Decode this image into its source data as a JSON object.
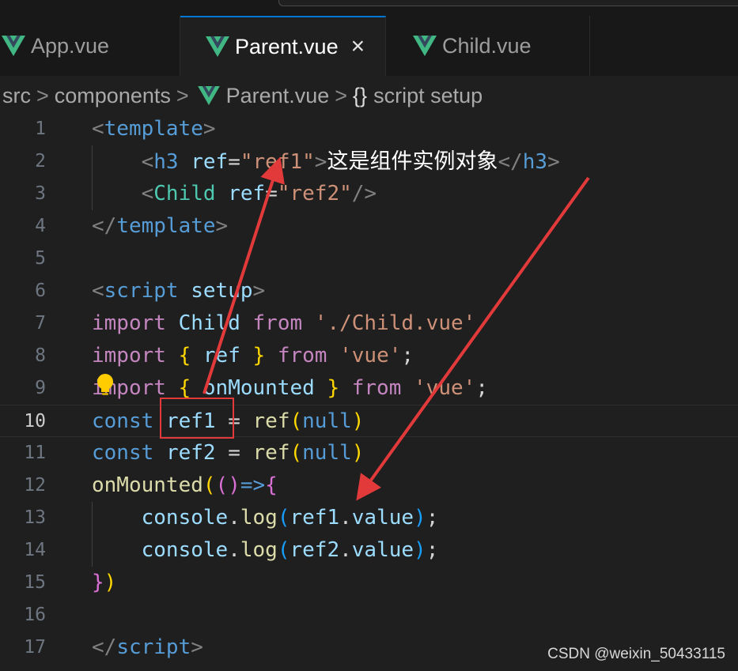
{
  "tabs": [
    {
      "label": "App.vue",
      "active": false
    },
    {
      "label": "Parent.vue",
      "active": true,
      "close": "×"
    },
    {
      "label": "Child.vue",
      "active": false
    }
  ],
  "breadcrumb": {
    "items": [
      "src",
      "components",
      "Parent.vue",
      "script setup"
    ],
    "separator": ">",
    "braces": "{}"
  },
  "editor": {
    "current_line": 10,
    "lines": [
      {
        "n": "1",
        "tokens": [
          [
            "tok-brk",
            "<"
          ],
          [
            "tok-tag",
            "template"
          ],
          [
            "tok-brk",
            ">"
          ]
        ]
      },
      {
        "n": "2",
        "tokens": [
          [
            "tok-op",
            "    "
          ],
          [
            "tok-brk",
            "<"
          ],
          [
            "tok-tag",
            "h3"
          ],
          [
            "tok-op",
            " "
          ],
          [
            "tok-attr",
            "ref"
          ],
          [
            "tok-op",
            "="
          ],
          [
            "tok-str",
            "\"ref1\""
          ],
          [
            "tok-brk",
            ">"
          ],
          [
            "cn",
            "这是组件实例对象"
          ],
          [
            "tok-brk",
            "</"
          ],
          [
            "tok-tag",
            "h3"
          ],
          [
            "tok-brk",
            ">"
          ]
        ]
      },
      {
        "n": "3",
        "tokens": [
          [
            "tok-op",
            "    "
          ],
          [
            "tok-brk",
            "<"
          ],
          [
            "tok-comp",
            "Child"
          ],
          [
            "tok-op",
            " "
          ],
          [
            "tok-attr",
            "ref"
          ],
          [
            "tok-op",
            "="
          ],
          [
            "tok-str",
            "\"ref2\""
          ],
          [
            "tok-brk",
            "/>"
          ]
        ]
      },
      {
        "n": "4",
        "tokens": [
          [
            "tok-brk",
            "</"
          ],
          [
            "tok-tag",
            "template"
          ],
          [
            "tok-brk",
            ">"
          ]
        ]
      },
      {
        "n": "5",
        "tokens": []
      },
      {
        "n": "6",
        "tokens": [
          [
            "tok-brk",
            "<"
          ],
          [
            "tok-tag",
            "script"
          ],
          [
            "tok-op",
            " "
          ],
          [
            "tok-attr",
            "setup"
          ],
          [
            "tok-brk",
            ">"
          ]
        ]
      },
      {
        "n": "7",
        "tokens": [
          [
            "tok-kw",
            "import"
          ],
          [
            "tok-op",
            " "
          ],
          [
            "tok-var",
            "Child"
          ],
          [
            "tok-op",
            " "
          ],
          [
            "tok-kw",
            "from"
          ],
          [
            "tok-op",
            " "
          ],
          [
            "tok-str",
            "'./Child.vue'"
          ]
        ]
      },
      {
        "n": "8",
        "tokens": [
          [
            "tok-kw",
            "import"
          ],
          [
            "tok-op",
            " "
          ],
          [
            "tok-p1",
            "{"
          ],
          [
            "tok-op",
            " "
          ],
          [
            "tok-var",
            "ref"
          ],
          [
            "tok-op",
            " "
          ],
          [
            "tok-p1",
            "}"
          ],
          [
            "tok-op",
            " "
          ],
          [
            "tok-kw",
            "from"
          ],
          [
            "tok-op",
            " "
          ],
          [
            "tok-str",
            "'vue'"
          ],
          [
            "tok-op",
            ";"
          ]
        ]
      },
      {
        "n": "9",
        "tokens": [
          [
            "tok-kw",
            "import"
          ],
          [
            "tok-op",
            " "
          ],
          [
            "tok-p1",
            "{"
          ],
          [
            "tok-op",
            " "
          ],
          [
            "tok-var",
            "onMounted"
          ],
          [
            "tok-op",
            " "
          ],
          [
            "tok-p1",
            "}"
          ],
          [
            "tok-op",
            " "
          ],
          [
            "tok-kw",
            "from"
          ],
          [
            "tok-op",
            " "
          ],
          [
            "tok-str",
            "'vue'"
          ],
          [
            "tok-op",
            ";"
          ]
        ]
      },
      {
        "n": "10",
        "tokens": [
          [
            "tok-kw2",
            "const"
          ],
          [
            "tok-op",
            " "
          ],
          [
            "tok-var",
            "ref1"
          ],
          [
            "tok-op",
            " = "
          ],
          [
            "tok-fn",
            "ref"
          ],
          [
            "tok-p1",
            "("
          ],
          [
            "tok-kw2",
            "null"
          ],
          [
            "tok-p1",
            ")"
          ]
        ]
      },
      {
        "n": "11",
        "tokens": [
          [
            "tok-kw2",
            "const"
          ],
          [
            "tok-op",
            " "
          ],
          [
            "tok-var",
            "ref2"
          ],
          [
            "tok-op",
            " = "
          ],
          [
            "tok-fn",
            "ref"
          ],
          [
            "tok-p1",
            "("
          ],
          [
            "tok-kw2",
            "null"
          ],
          [
            "tok-p1",
            ")"
          ]
        ]
      },
      {
        "n": "12",
        "tokens": [
          [
            "tok-fn",
            "onMounted"
          ],
          [
            "tok-p1",
            "("
          ],
          [
            "tok-p2",
            "()"
          ],
          [
            "tok-kw2",
            "=>"
          ],
          [
            "tok-p2",
            "{"
          ]
        ]
      },
      {
        "n": "13",
        "tokens": [
          [
            "tok-op",
            "    "
          ],
          [
            "tok-var",
            "console"
          ],
          [
            "tok-op",
            "."
          ],
          [
            "tok-fn",
            "log"
          ],
          [
            "tok-p3",
            "("
          ],
          [
            "tok-var",
            "ref1"
          ],
          [
            "tok-op",
            "."
          ],
          [
            "tok-var",
            "value"
          ],
          [
            "tok-p3",
            ")"
          ],
          [
            "tok-op",
            ";"
          ]
        ]
      },
      {
        "n": "14",
        "tokens": [
          [
            "tok-op",
            "    "
          ],
          [
            "tok-var",
            "console"
          ],
          [
            "tok-op",
            "."
          ],
          [
            "tok-fn",
            "log"
          ],
          [
            "tok-p3",
            "("
          ],
          [
            "tok-var",
            "ref2"
          ],
          [
            "tok-op",
            "."
          ],
          [
            "tok-var",
            "value"
          ],
          [
            "tok-p3",
            ")"
          ],
          [
            "tok-op",
            ";"
          ]
        ]
      },
      {
        "n": "15",
        "tokens": [
          [
            "tok-p2",
            "}"
          ],
          [
            "tok-p1",
            ")"
          ]
        ]
      },
      {
        "n": "16",
        "tokens": []
      },
      {
        "n": "17",
        "tokens": [
          [
            "tok-brk",
            "</"
          ],
          [
            "tok-tag",
            "script"
          ],
          [
            "tok-brk",
            ">"
          ]
        ]
      }
    ]
  },
  "icons": {
    "vue": "vue-logo-icon",
    "bulb": "lightbulb-icon",
    "vue_colors": [
      "#41b883",
      "#34495e"
    ],
    "bulb_color": "#ffcc00"
  },
  "annotation": {
    "color": "#e23a3a"
  },
  "watermark": "CSDN @weixin_50433115"
}
